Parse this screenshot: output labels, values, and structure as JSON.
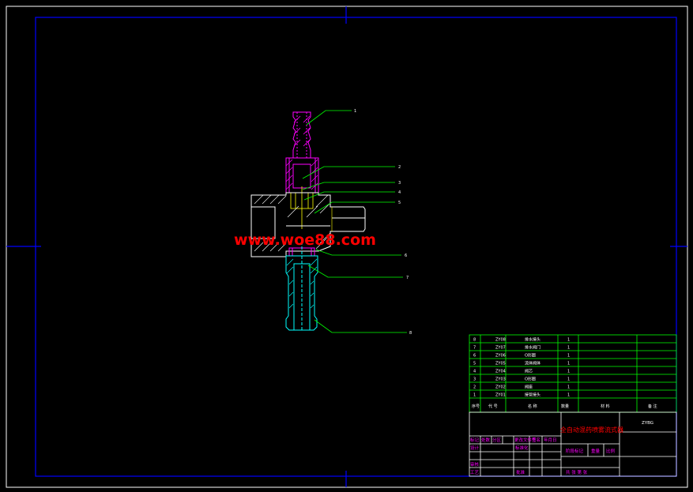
{
  "colors": {
    "background": "#000000",
    "frame": "#0000ff",
    "border": "#ffffff",
    "table_lines": "#00ff00",
    "leader": "#00ff00",
    "part_magenta": "#ff00ff",
    "part_cyan": "#00ffff",
    "part_yellow": "#ffff00",
    "watermark": "#ff0000"
  },
  "watermark": "www.woe88.com",
  "balloons": [
    "1",
    "2",
    "3",
    "4",
    "5",
    "6",
    "7",
    "8"
  ],
  "parts": [
    {
      "no": "8",
      "code": "ZY08",
      "name": "排水接头",
      "qty": "1"
    },
    {
      "no": "7",
      "code": "ZY07",
      "name": "排水阀门",
      "qty": "1"
    },
    {
      "no": "6",
      "code": "ZY06",
      "name": "O形圈",
      "qty": "1"
    },
    {
      "no": "5",
      "code": "ZY05",
      "name": "流体阀体",
      "qty": "1"
    },
    {
      "no": "4",
      "code": "ZY04",
      "name": "阀芯",
      "qty": "1"
    },
    {
      "no": "3",
      "code": "ZY03",
      "name": "O形圈",
      "qty": "1"
    },
    {
      "no": "2",
      "code": "ZY02",
      "name": "阀座",
      "qty": "1"
    },
    {
      "no": "1",
      "code": "ZY01",
      "name": "接管接头",
      "qty": "1"
    }
  ],
  "parts_header": {
    "no": "序号",
    "code": "代  号",
    "name": "名  称",
    "qty": "数量",
    "material": "材  料",
    "remark": "备  注"
  },
  "title_block": {
    "title": "全自动混药喷雾流式器",
    "drawing_no": "ZYBG",
    "rev_labels": [
      "标记",
      "处数",
      "分区",
      "更改文件号",
      "签名",
      "年月日"
    ],
    "design": "设计",
    "standardize": "标准化",
    "stage_mark": "阶段标记",
    "weight": "重量",
    "scale": "比例",
    "review": "审核",
    "process": "工艺",
    "approve": "批准",
    "sheets": "共  张  第  张"
  }
}
